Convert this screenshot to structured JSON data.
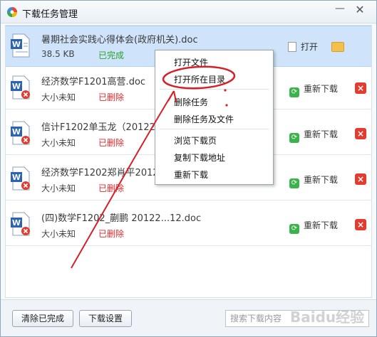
{
  "window": {
    "title": "下载任务管理",
    "minimize": "—",
    "close": "✕"
  },
  "tasks": [
    {
      "name": "暑期社会实践心得体会(政府机关).doc",
      "size": "38.5 KB",
      "status": "已完成",
      "action": "打开"
    },
    {
      "name": "经济数学F1201高营.doc",
      "size": "大小未知",
      "status": "已删除",
      "action": "重新下载"
    },
    {
      "name": "信计F1202单玉龙（2012219",
      "size": "大小未知",
      "status": "已删除",
      "action": "重新下载"
    },
    {
      "name": "经济数学F1202郑肖平20122",
      "size": "大小未知",
      "status": "已删除",
      "action": "重新下载"
    },
    {
      "name": "(四)数学F1202_蒯鹏 20122...12.doc",
      "size": "大小未知",
      "status": "已删除",
      "action": "重新下载"
    }
  ],
  "context_menu": {
    "items": [
      "打开文件",
      "打开所在目录",
      "删除任务",
      "删除任务及文件",
      "浏览下载页",
      "复制下载地址",
      "重新下载"
    ]
  },
  "footer": {
    "clear_label": "清除已完成",
    "settings_label": "下载设置",
    "search_placeholder": "搜索下载内容",
    "watermark": "Baidu经验"
  },
  "colors": {
    "done": "#2aa02a",
    "deleted": "#e02a2a",
    "selected_row": "#cfe4fb",
    "annotation": "#d61f26"
  }
}
